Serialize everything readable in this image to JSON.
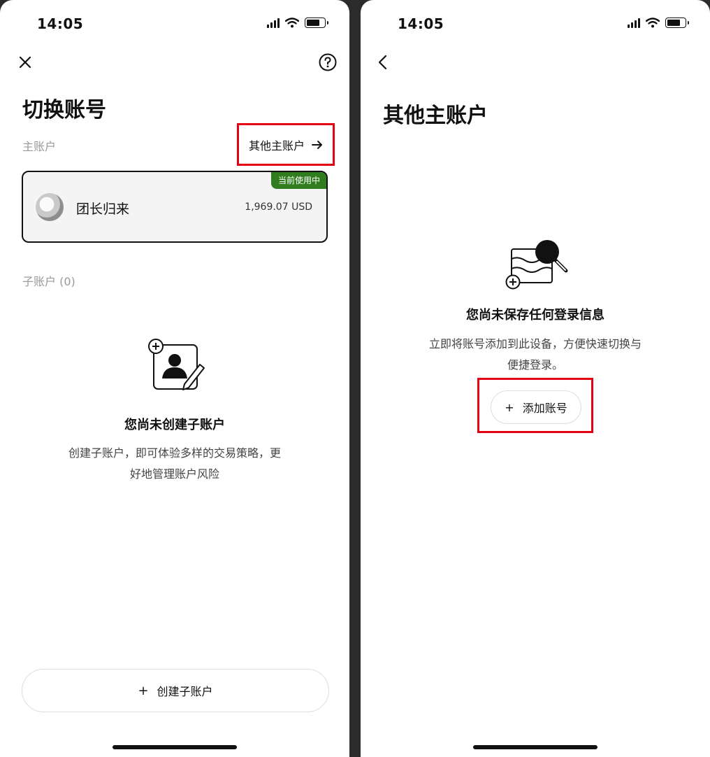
{
  "status": {
    "time": "14:05"
  },
  "left": {
    "title": "切换账号",
    "main_accounts_label": "主账户",
    "other_accounts_link": "其他主账户",
    "account": {
      "name": "团长归来",
      "balance": "1,969.07 USD",
      "badge": "当前使用中"
    },
    "sub_accounts_label": "子账户 (0)",
    "empty_title": "您尚未创建子账户",
    "empty_desc_line1": "创建子账户，即可体验多样的交易策略，更",
    "empty_desc_line2": "好地管理账户风险",
    "create_button": "创建子账户",
    "create_button_icon": "+"
  },
  "right": {
    "title": "其他主账户",
    "empty_title": "您尚未保存任何登录信息",
    "empty_desc_line1": "立即将账号添加到此设备，方便快速切换与",
    "empty_desc_line2": "便捷登录。",
    "add_button": "添加账号",
    "add_button_icon": "+"
  },
  "colors": {
    "badge_green": "#2f7d1f",
    "highlight_red": "#e60012"
  },
  "icons": [
    "close-icon",
    "help-icon",
    "arrow-right-icon",
    "back-icon",
    "add-subaccount-illustration",
    "search-wallet-illustration",
    "signal-icon",
    "wifi-icon",
    "battery-icon"
  ]
}
